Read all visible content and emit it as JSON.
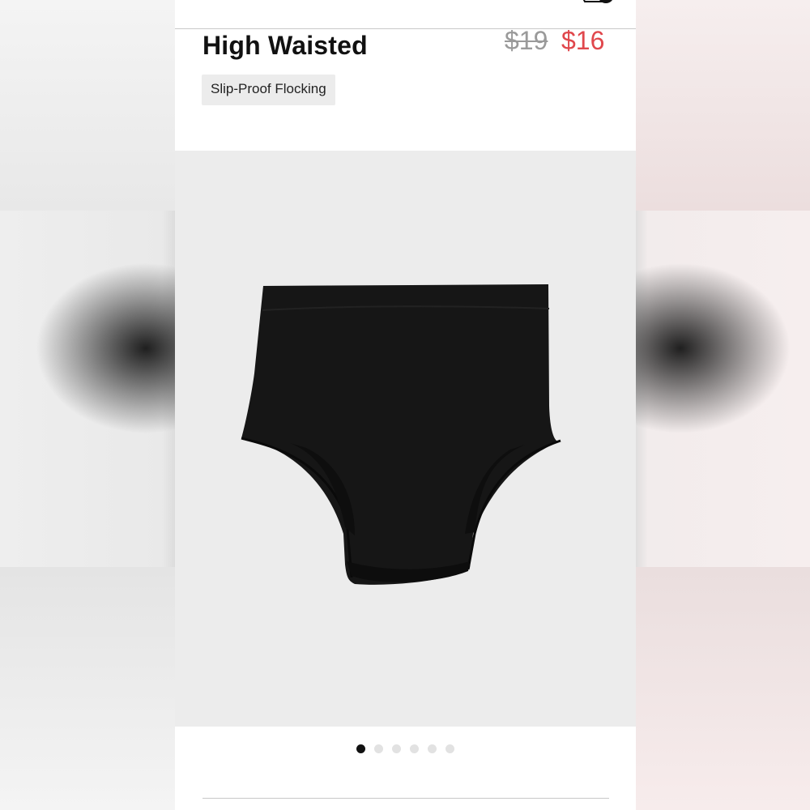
{
  "product": {
    "title": "High Waisted",
    "price_original": "$19",
    "price_sale": "$16",
    "tag": "Slip-Proof Flocking",
    "image_alt": "black high-waisted brief",
    "image_count": 6,
    "active_image_index": 0
  },
  "icons": {
    "cart": "cart-icon",
    "carousel_dot": "dot-indicator"
  },
  "colors": {
    "sale_price": "#e0474c",
    "original_price": "#9a9a9a",
    "tag_background": "#ececec",
    "image_background": "#ececec",
    "active_dot": "#111111",
    "inactive_dot": "#e2e2e2"
  }
}
